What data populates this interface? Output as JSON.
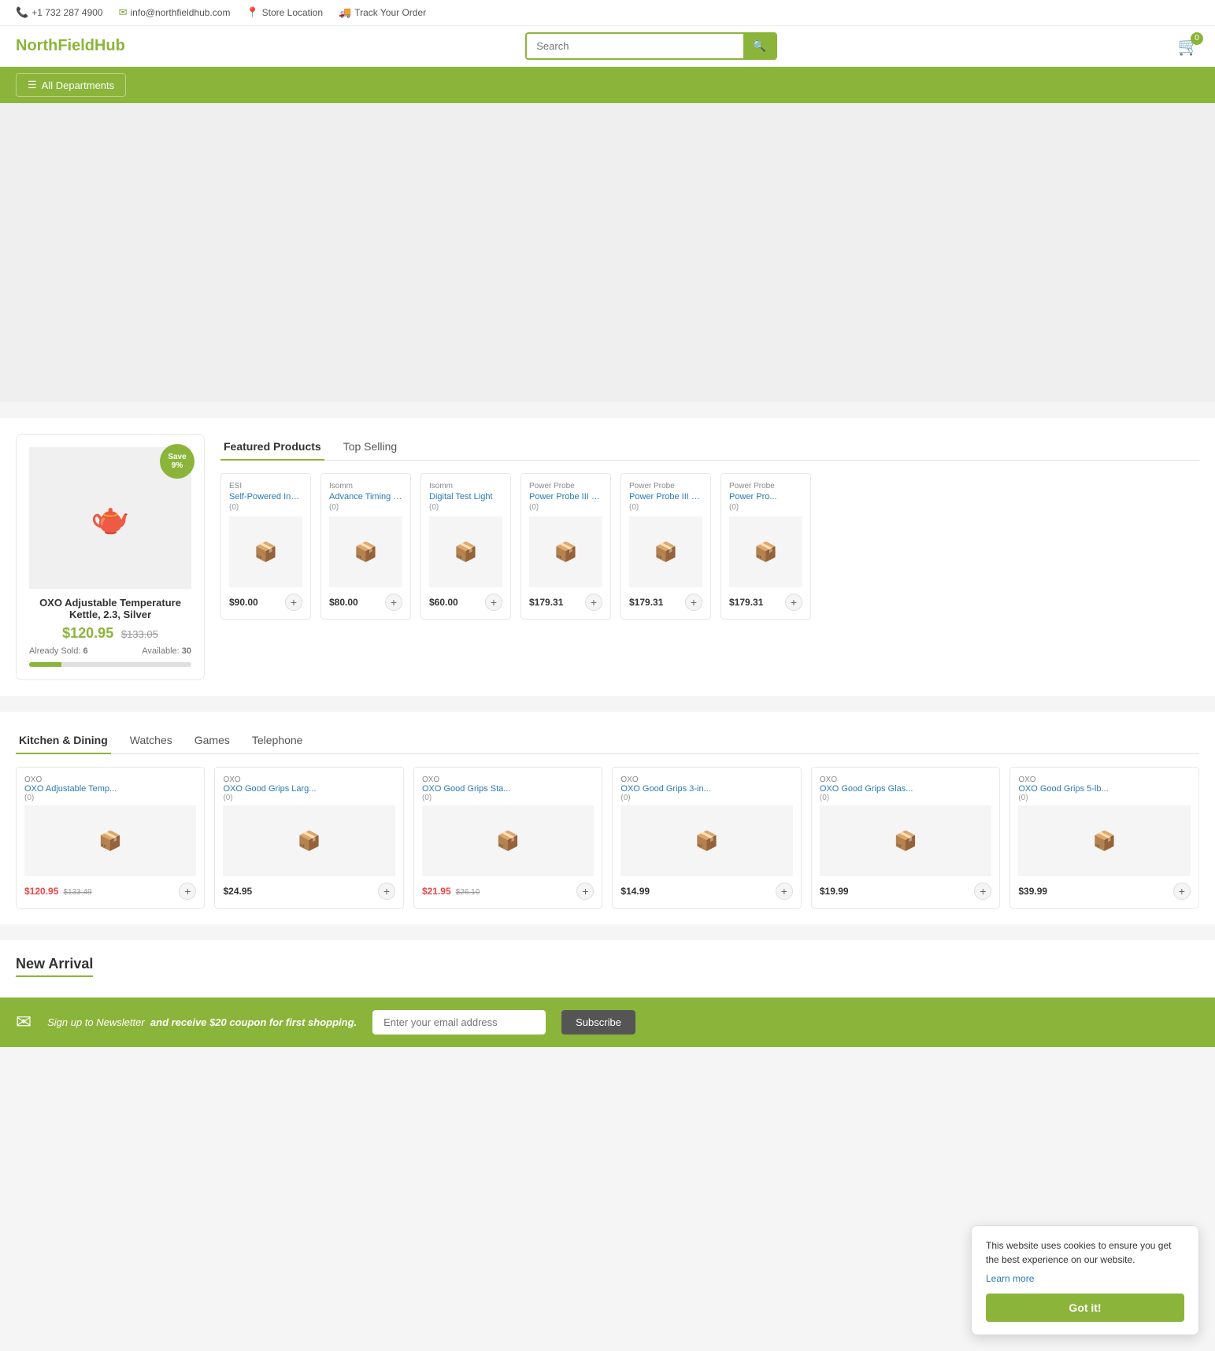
{
  "topbar": {
    "phone": "+1 732 287 4900",
    "email": "info@northfieldhub.com",
    "store_location": "Store Location",
    "track_order": "Track Your Order"
  },
  "header": {
    "search_placeholder": "Search",
    "cart_count": "0"
  },
  "nav": {
    "all_departments": "All Departments"
  },
  "featured": {
    "tabs": [
      {
        "label": "Featured Products",
        "active": true
      },
      {
        "label": "Top Selling",
        "active": false
      }
    ],
    "main_product": {
      "title": "OXO Adjustable Temperature Kettle, 2.3, Silver",
      "price_current": "$120.95",
      "price_original": "$133.05",
      "already_sold": "6",
      "available": "30",
      "save_label": "Save",
      "save_pct": "9%",
      "progress_pct": 20
    },
    "products": [
      {
        "brand": "ESI",
        "name": "Self-Powered Inductive ...",
        "rating": "(0)",
        "price": "$90.00"
      },
      {
        "brand": "Isomm",
        "name": "Advance Timing Light",
        "rating": "(0)",
        "price": "$80.00"
      },
      {
        "brand": "Isomm",
        "name": "Digital Test Light",
        "rating": "(0)",
        "price": "$60.00"
      },
      {
        "brand": "Power Probe",
        "name": "Power Probe III with Ca...",
        "rating": "(0)",
        "price": "$179.31"
      },
      {
        "brand": "Power Probe",
        "name": "Power Probe III with Ca...",
        "rating": "(0)",
        "price": "$179.31"
      },
      {
        "brand": "Power Probe",
        "name": "Power Pro...",
        "rating": "(0)",
        "price": "$179.31"
      }
    ]
  },
  "categories": {
    "tabs": [
      {
        "label": "Kitchen & Dining",
        "active": true
      },
      {
        "label": "Watches",
        "active": false
      },
      {
        "label": "Games",
        "active": false
      },
      {
        "label": "Telephone",
        "active": false
      }
    ],
    "products": [
      {
        "brand": "OXO",
        "name": "OXO Adjustable Temp...",
        "rating": "(0)",
        "price": "$120.95",
        "original": "$133.49",
        "sale": true
      },
      {
        "brand": "OXO",
        "name": "OXO Good Grips Larg...",
        "rating": "(0)",
        "price": "$24.95",
        "original": "",
        "sale": false
      },
      {
        "brand": "OXO",
        "name": "OXO Good Grips Sta...",
        "rating": "(0)",
        "price": "$21.95",
        "original": "$26.10",
        "sale": true
      },
      {
        "brand": "OXO",
        "name": "OXO Good Grips 3-in...",
        "rating": "(0)",
        "price": "$14.99",
        "original": "",
        "sale": false
      },
      {
        "brand": "OXO",
        "name": "OXO Good Grips Glas...",
        "rating": "(0)",
        "price": "$19.99",
        "original": "",
        "sale": false
      },
      {
        "brand": "OXO",
        "name": "OXO Good Grips 5-lb...",
        "rating": "(0)",
        "price": "$39.99",
        "original": "",
        "sale": false
      }
    ]
  },
  "new_arrival": {
    "title": "New Arrival"
  },
  "newsletter": {
    "icon": "✉",
    "text": "Sign up to Newsletter",
    "coupon_text": "and receive $20 coupon for first shopping.",
    "input_placeholder": "Enter your email address",
    "btn_label": "Subscribe"
  },
  "cookie": {
    "message": "This website uses cookies to ensure you get the best experience on our website.",
    "learn_more": "Learn more",
    "btn_label": "Got it!"
  }
}
